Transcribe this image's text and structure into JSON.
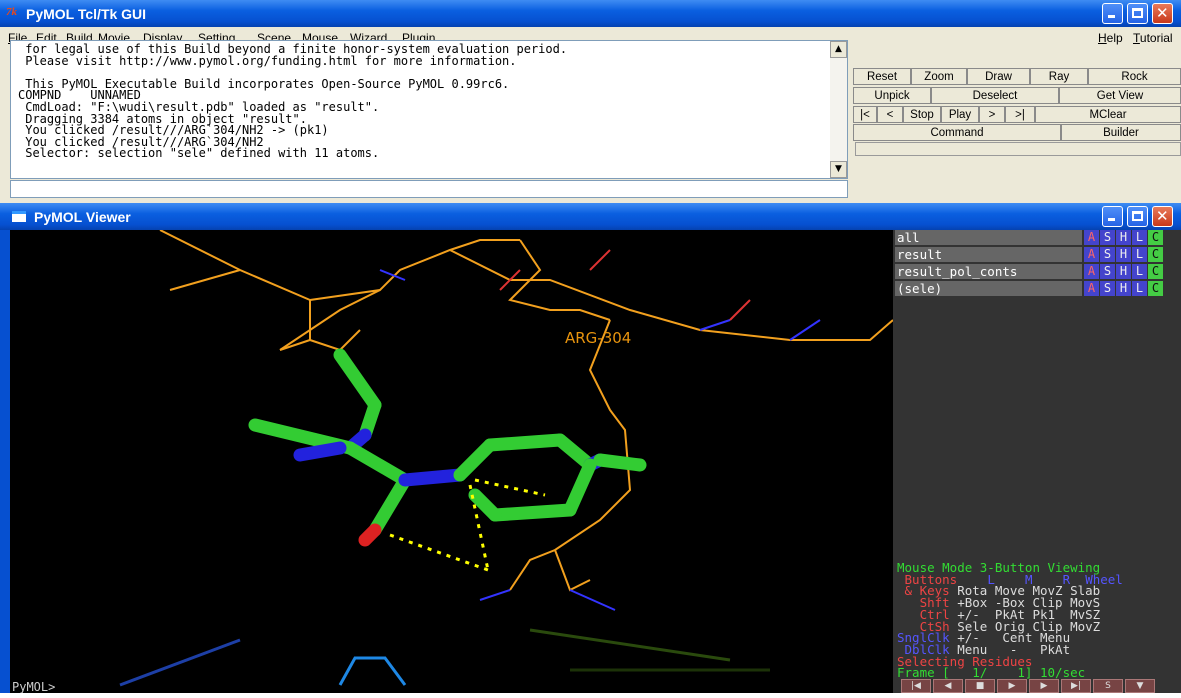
{
  "tk_window": {
    "title": "PyMOL Tcl/Tk GUI",
    "logo": "7k",
    "menu": [
      "File",
      "Edit",
      "Build",
      "Movie",
      "Display",
      "Setting",
      "Scene",
      "Mouse",
      "Wizard",
      "Plugin"
    ],
    "menu_right": [
      "Help",
      "Tutorial"
    ],
    "log_lines": [
      " for legal use of this Build beyond a finite honor-system evaluation period.",
      " Please visit http://www.pymol.org/funding.html for more information.",
      "",
      " This PyMOL Executable Build incorporates Open-Source PyMOL 0.99rc6.",
      "COMPND    UNNAMED",
      " CmdLoad: \"F:\\wudi\\result.pdb\" loaded as \"result\".",
      " Dragging 3384 atoms in object \"result\".",
      " You clicked /result///ARG`304/NH2 -> (pk1)",
      " You clicked /result///ARG`304/NH2",
      " Selector: selection \"sele\" defined with 11 atoms."
    ],
    "command_value": "",
    "buttons": {
      "row1": [
        "Reset",
        "Zoom",
        "Draw",
        "Ray",
        "Rock"
      ],
      "row2": [
        "Unpick",
        "Deselect",
        "Get View"
      ],
      "row3": [
        "|<",
        "<",
        "Stop",
        "Play",
        ">",
        ">|",
        "MClear"
      ],
      "row4": [
        "Command",
        "Builder"
      ]
    }
  },
  "viewer_window": {
    "title": "PyMOL Viewer",
    "atom_label": "ARG-304",
    "prompt": "PyMOL>_",
    "objects": [
      {
        "name": "all"
      },
      {
        "name": "result"
      },
      {
        "name": "result_pol_conts"
      },
      {
        "name": "(sele)"
      }
    ],
    "object_buttons": [
      "A",
      "S",
      "H",
      "L",
      "C"
    ],
    "mouse_mode": {
      "line1": "Mouse Mode 3-Button Viewing",
      "buttons_row": {
        "label": " Buttons",
        "l": "L",
        "m": "M",
        "r": "R",
        "wheel": "Wheel"
      },
      "keys_row": {
        "label": " & Keys",
        "values": "Rota Move MovZ Slab"
      },
      "shft_row": {
        "label": "   Shft",
        "values": "+Box -Box Clip MovS"
      },
      "ctrl_row": {
        "label": "   Ctrl",
        "values": "+/-  PkAt Pk1  MvSZ"
      },
      "ctsh_row": {
        "label": "   CtSh",
        "values": "Sele Orig Clip MovZ"
      },
      "sngl_row": {
        "label": "SnglClk",
        "values": "+/-   Cent Menu"
      },
      "dbl_row": {
        "label": " DblClk",
        "values": "Menu   -   PkAt"
      },
      "selecting": "Selecting Residues",
      "frame": "Frame [   1/    1] 10/sec"
    },
    "frame_buttons": [
      "|◀",
      "◀",
      "■",
      "▶",
      "▶",
      "▶|",
      "S",
      "▼"
    ]
  },
  "colors": {
    "titlebar_blue": "#0a5fe0",
    "carbon_green": "#33cc33",
    "nitrogen_blue": "#2222dd",
    "oxygen_red": "#dd2222",
    "orange_chain": "#f2a01e",
    "hbond_yellow": "#ffff00"
  }
}
